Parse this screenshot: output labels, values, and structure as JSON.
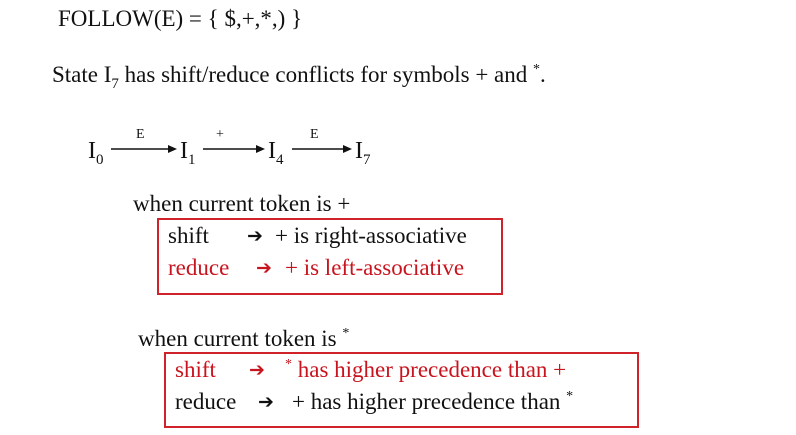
{
  "follow": {
    "text": "FOLLOW(E) = { $,+,*,) }"
  },
  "conflict": {
    "prefix": "State I",
    "sub": "7",
    "middle": " has shift/reduce conflicts for symbols + and ",
    "star": "*",
    "suffix": "."
  },
  "path": {
    "states": [
      {
        "name": "I",
        "sub": "0"
      },
      {
        "name": "I",
        "sub": "1"
      },
      {
        "name": "I",
        "sub": "4"
      },
      {
        "name": "I",
        "sub": "7"
      }
    ],
    "transitions": [
      "E",
      "+",
      "E"
    ]
  },
  "case_plus": {
    "heading": "when current token is +",
    "rows": [
      {
        "action": "shift",
        "result": "+ is right-associative"
      },
      {
        "action": "reduce",
        "result": "+ is left-associative"
      }
    ]
  },
  "case_star": {
    "heading": "when current token is ",
    "heading_symbol": "*",
    "rows": [
      {
        "action": "shift",
        "star": "*",
        "result": " has higher precedence than +"
      },
      {
        "action": "reduce",
        "result": "+ has higher precedence than ",
        "star": "*"
      }
    ]
  },
  "colors": {
    "accent_red": "#c8141e",
    "box_border": "#d0222a"
  }
}
